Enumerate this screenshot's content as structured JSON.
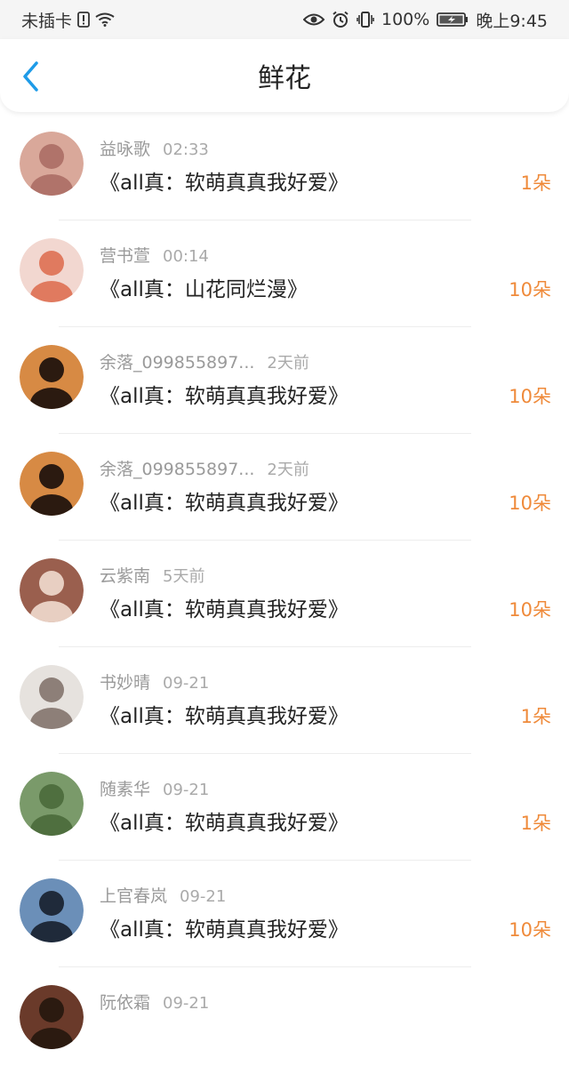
{
  "status_bar": {
    "carrier": "未插卡",
    "battery": "100%",
    "time": "晚上9:45"
  },
  "header": {
    "title": "鲜花"
  },
  "list": [
    {
      "name": "益咏歌",
      "time": "02:33",
      "title": "《all真：软萌真真我好爱》",
      "count": "1朵",
      "avatar": {
        "bg": "#d9a89a",
        "fg": "#b0736a"
      }
    },
    {
      "name": "营书萱",
      "time": "00:14",
      "title": "《all真：山花同烂漫》",
      "count": "10朵",
      "avatar": {
        "bg": "#f2d7d0",
        "fg": "#e07a5f"
      }
    },
    {
      "name": "余落_099855897...",
      "time": "2天前",
      "title": "《all真：软萌真真我好爱》",
      "count": "10朵",
      "avatar": {
        "bg": "#d78a44",
        "fg": "#2b1a10"
      }
    },
    {
      "name": "余落_099855897...",
      "time": "2天前",
      "title": "《all真：软萌真真我好爱》",
      "count": "10朵",
      "avatar": {
        "bg": "#d78a44",
        "fg": "#2b1a10"
      }
    },
    {
      "name": "云紫南",
      "time": "5天前",
      "title": "《all真：软萌真真我好爱》",
      "count": "10朵",
      "avatar": {
        "bg": "#9a5f4e",
        "fg": "#e8cfc2"
      }
    },
    {
      "name": "书妙晴",
      "time": "09-21",
      "title": "《all真：软萌真真我好爱》",
      "count": "1朵",
      "avatar": {
        "bg": "#e6e2de",
        "fg": "#8d7f78"
      }
    },
    {
      "name": "随素华",
      "time": "09-21",
      "title": "《all真：软萌真真我好爱》",
      "count": "1朵",
      "avatar": {
        "bg": "#7a9a6a",
        "fg": "#4f6f3f"
      }
    },
    {
      "name": "上官春岚",
      "time": "09-21",
      "title": "《all真：软萌真真我好爱》",
      "count": "10朵",
      "avatar": {
        "bg": "#6b8fb8",
        "fg": "#1f2a3a"
      }
    },
    {
      "name": "阮依霜",
      "time": "09-21",
      "title": "",
      "count": "",
      "avatar": {
        "bg": "#6a3a2a",
        "fg": "#2b1a10"
      }
    }
  ]
}
